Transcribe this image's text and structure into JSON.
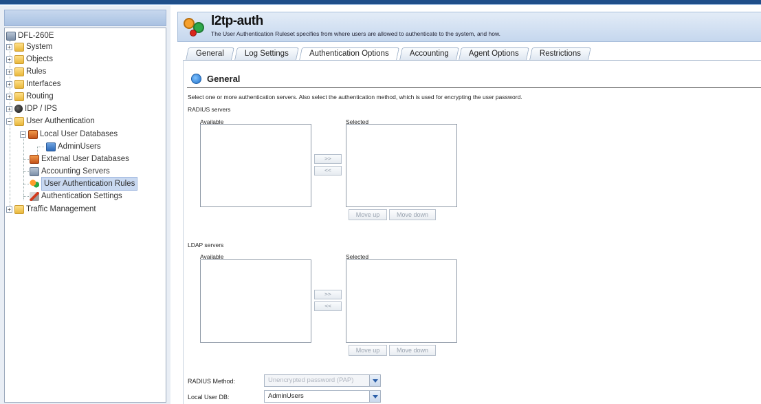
{
  "sidebar": {
    "items": [
      {
        "label": "DFL-260E"
      },
      {
        "label": "System"
      },
      {
        "label": "Objects"
      },
      {
        "label": "Rules"
      },
      {
        "label": "Interfaces"
      },
      {
        "label": "Routing"
      },
      {
        "label": "IDP / IPS"
      },
      {
        "label": "User Authentication"
      },
      {
        "label": "Local User Databases"
      },
      {
        "label": "AdminUsers"
      },
      {
        "label": "External User Databases"
      },
      {
        "label": "Accounting Servers"
      },
      {
        "label": "User Authentication Rules"
      },
      {
        "label": "Authentication Settings"
      },
      {
        "label": "Traffic Management"
      }
    ]
  },
  "header": {
    "title": "l2tp-auth",
    "description": "The User Authentication Ruleset specifies from where users are allowed to authenticate to the system, and how."
  },
  "tabs": [
    {
      "label": "General"
    },
    {
      "label": "Log Settings"
    },
    {
      "label": "Authentication Options"
    },
    {
      "label": "Accounting"
    },
    {
      "label": "Agent Options"
    },
    {
      "label": "Restrictions"
    }
  ],
  "section": {
    "title": "General",
    "instructions": "Select one or more authentication servers. Also select the authentication method, which is used for encrypting the user password."
  },
  "radius": {
    "label": "RADIUS servers",
    "available_label": "Available",
    "selected_label": "Selected",
    "add_label": ">>",
    "remove_label": "<<",
    "move_up_label": "Move up",
    "move_down_label": "Move down"
  },
  "ldap": {
    "label": "LDAP servers",
    "available_label": "Available",
    "selected_label": "Selected",
    "add_label": ">>",
    "remove_label": "<<",
    "move_up_label": "Move up",
    "move_down_label": "Move down"
  },
  "form": {
    "radius_method_label": "RADIUS Method:",
    "radius_method_value": "Unencrypted password (PAP)",
    "local_user_db_label": "Local User DB:",
    "local_user_db_value": "AdminUsers"
  }
}
